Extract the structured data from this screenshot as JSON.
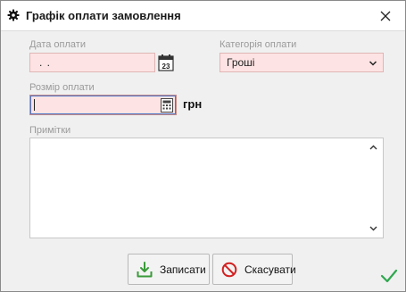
{
  "window": {
    "title": "Графік оплати замовлення"
  },
  "icons": {
    "title": "gear-icon",
    "close": "close-icon",
    "calendar": "calendar-icon",
    "calendar_day": "23",
    "calculator": "calculator-icon",
    "dropdown": "chevron-down-icon",
    "save": "download-tray-icon",
    "cancel": "no-entry-icon",
    "status": "checkmark-icon"
  },
  "form": {
    "date": {
      "label": "Дата оплати",
      "value": " .  ."
    },
    "category": {
      "label": "Категорія оплати",
      "value": "Гроші"
    },
    "amount": {
      "label": "Розмір оплати",
      "value": "",
      "currency": "грн"
    },
    "notes": {
      "label": "Примітки",
      "value": ""
    }
  },
  "buttons": {
    "save": "Записати",
    "cancel": "Скасувати"
  },
  "colors": {
    "required_field_bg": "#fde3e3",
    "save_icon": "#3a9a3a",
    "cancel_icon": "#d32020",
    "status_check": "#2fa84f",
    "focus_border": "#4a78c8"
  }
}
